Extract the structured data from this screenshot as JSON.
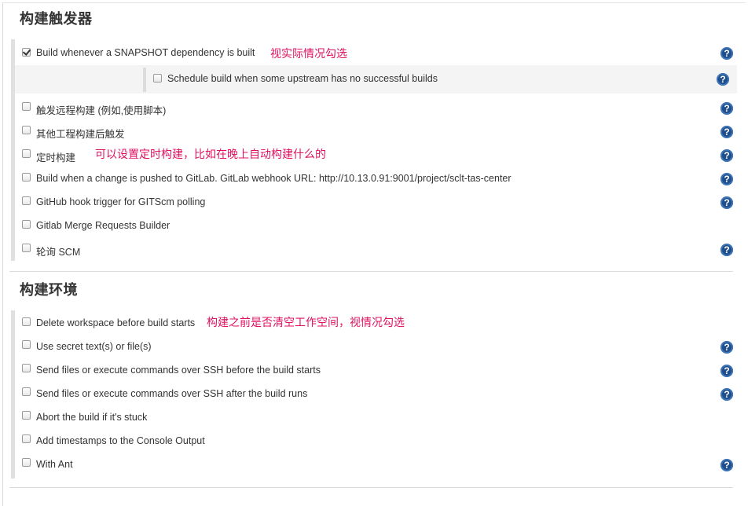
{
  "trigger_section": {
    "title": "构建触发器",
    "items": [
      {
        "label": "Build whenever a SNAPSHOT dependency is built",
        "checked": true,
        "note": "视实际情况勾选",
        "help": true
      },
      {
        "label": "Schedule build when some upstream has no successful builds",
        "checked": false,
        "note": "",
        "help": true
      },
      {
        "label": "触发远程构建 (例如,使用脚本)",
        "checked": false,
        "note": "",
        "help": true
      },
      {
        "label": "其他工程构建后触发",
        "checked": false,
        "note": "",
        "help": true
      },
      {
        "label": "定时构建",
        "checked": false,
        "note": "可以设置定时构建，比如在晚上自动构建什么的",
        "help": true
      },
      {
        "label": "Build when a change is pushed to GitLab. GitLab webhook URL: http://10.13.0.91:9001/project/sclt-tas-center",
        "checked": false,
        "note": "",
        "help": true
      },
      {
        "label": "GitHub hook trigger for GITScm polling",
        "checked": false,
        "note": "",
        "help": true
      },
      {
        "label": "Gitlab Merge Requests Builder",
        "checked": false,
        "note": "",
        "help": false
      },
      {
        "label": "轮询 SCM",
        "checked": false,
        "note": "",
        "help": true
      }
    ]
  },
  "env_section": {
    "title": "构建环境",
    "items": [
      {
        "label": "Delete workspace before build starts",
        "checked": false,
        "note": "构建之前是否清空工作空间，视情况勾选",
        "help": false
      },
      {
        "label": "Use secret text(s) or file(s)",
        "checked": false,
        "note": "",
        "help": true
      },
      {
        "label": "Send files or execute commands over SSH before the build starts",
        "checked": false,
        "note": "",
        "help": true
      },
      {
        "label": "Send files or execute commands over SSH after the build runs",
        "checked": false,
        "note": "",
        "help": true
      },
      {
        "label": "Abort the build if it's stuck",
        "checked": false,
        "note": "",
        "help": false
      },
      {
        "label": "Add timestamps to the Console Output",
        "checked": false,
        "note": "",
        "help": false
      },
      {
        "label": "With Ant",
        "checked": false,
        "note": "",
        "help": true
      }
    ]
  },
  "help_glyph": "?",
  "icons": {
    "help": "help-icon",
    "checkbox": "checkbox"
  }
}
